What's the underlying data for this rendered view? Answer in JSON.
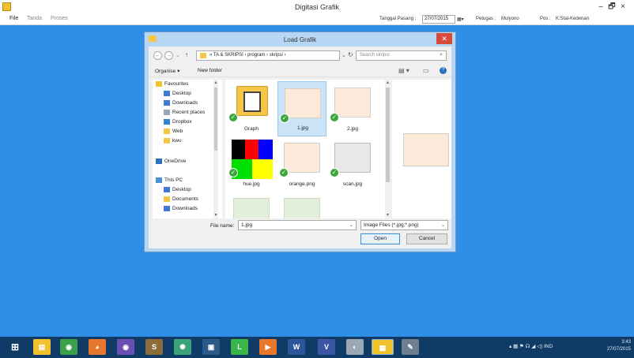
{
  "app": {
    "title": "Digitasi Grafik",
    "min_glyph": "–",
    "restore_glyph": "🗗",
    "close_glyph": "×",
    "menu": [
      "File",
      "Tanda",
      "Proses"
    ],
    "fields": {
      "date_label": "Tanggal Pasang :",
      "date_value": "27/07/2015",
      "petugas_label": "Petugas :",
      "petugas_value": "Mulyono",
      "pos_label": "Pos :",
      "pos_value": "K.Stal-Kedenan"
    }
  },
  "dialog": {
    "title": "Load Grafik",
    "close_glyph": "✕",
    "nav": {
      "back_glyph": "←",
      "forward_glyph": "→",
      "recent_glyph": "⌄",
      "up_glyph": "↑",
      "dropdown_glyph": "⌄",
      "refresh_glyph": "↻"
    },
    "address": "« TA & SKRIPSI › program › skripsi ›",
    "search_placeholder": "Search skripsi",
    "search_glyph": "⌕",
    "organise": "Organise ▾",
    "new_folder": "New folder",
    "view_glyph": "▤ ▾",
    "pane_glyph": "▭",
    "help_glyph": "?",
    "nav_items": [
      {
        "label": "Favourites",
        "color": "#f2c22e"
      },
      {
        "label": "Desktop",
        "color": "#3d7bd6"
      },
      {
        "label": "Downloads",
        "color": "#3d7bd6"
      },
      {
        "label": "Recent places",
        "color": "#9aa7b4"
      },
      {
        "label": "Dropbox",
        "color": "#2b84d8"
      },
      {
        "label": "Web",
        "color": "#f4c745"
      },
      {
        "label": "kwu",
        "color": "#f4c745"
      },
      {
        "label": "OneDrive",
        "color": "#2b6fbf"
      },
      {
        "label": "This PC",
        "color": "#4a90d9"
      },
      {
        "label": "Desktop",
        "color": "#3d7bd6"
      },
      {
        "label": "Documents",
        "color": "#f4c745"
      },
      {
        "label": "Downloads",
        "color": "#3d7bd6"
      }
    ],
    "nav_scroll_up": "▴",
    "nav_scroll_down": "▾",
    "check_glyph": "✓",
    "files": [
      {
        "name": "Graph"
      },
      {
        "name": "1.jpg"
      },
      {
        "name": "2.jpg"
      },
      {
        "name": "hue.jpg"
      },
      {
        "name": "orange.png"
      },
      {
        "name": "scan.jpg"
      }
    ],
    "content_scroll_up": "▴",
    "content_scroll_down": "▾",
    "file_name_label": "File name:",
    "file_name_value": "1.jpg",
    "file_type": "Image Files (*.jpg;*.png)",
    "dropdown_glyph": "⌄",
    "open_label": "Open",
    "cancel_label": "Cancel"
  },
  "taskbar": {
    "apps": [
      {
        "name": "start",
        "glyph": "⊞",
        "color": "#0f3b66"
      },
      {
        "name": "explorer",
        "glyph": "▤",
        "color": "#f2c22e"
      },
      {
        "name": "chrome",
        "glyph": "◉",
        "color": "#3aa14a"
      },
      {
        "name": "firefox",
        "glyph": "◕",
        "color": "#e8772e"
      },
      {
        "name": "app-purple",
        "glyph": "◉",
        "color": "#6a4fb3"
      },
      {
        "name": "app-s",
        "glyph": "S",
        "color": "#8a6d3b"
      },
      {
        "name": "atom",
        "glyph": "✺",
        "color": "#3aa37a"
      },
      {
        "name": "app-box",
        "glyph": "▣",
        "color": "#2a5a8a"
      },
      {
        "name": "line",
        "glyph": "L",
        "color": "#39b54a"
      },
      {
        "name": "media",
        "glyph": "▶",
        "color": "#e8772e"
      },
      {
        "name": "word",
        "glyph": "W",
        "color": "#2b579a"
      },
      {
        "name": "visio",
        "glyph": "V",
        "color": "#3955a3"
      },
      {
        "name": "paint",
        "glyph": "◐",
        "color": "#9aa7b4"
      },
      {
        "name": "digitasi",
        "glyph": "▦",
        "color": "#f2c22e"
      },
      {
        "name": "tools",
        "glyph": "✎",
        "color": "#6d7f91"
      }
    ],
    "tray": "▴  ▦ ⚑ ☊ ◢ ◁)  IND",
    "time": "3:43",
    "date": "27/07/2015"
  }
}
